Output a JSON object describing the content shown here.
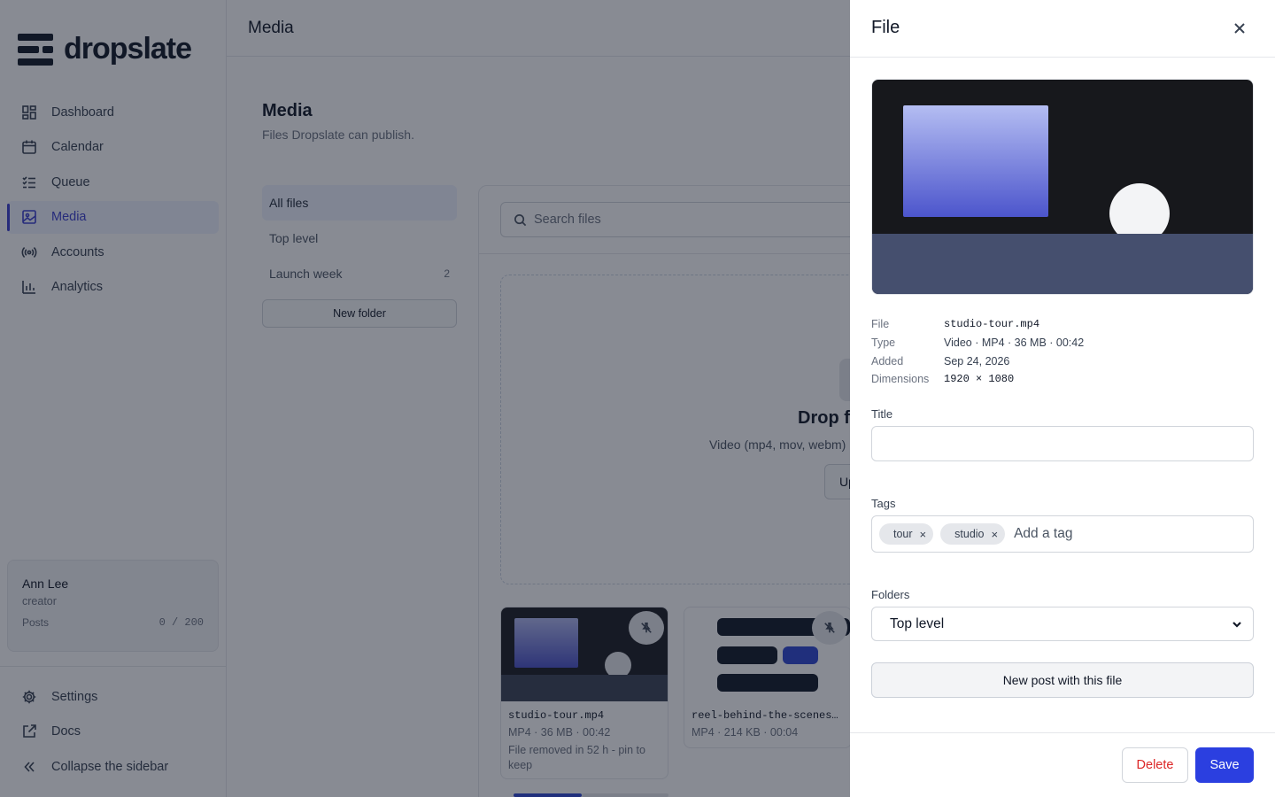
{
  "app": {
    "name": "dropslate"
  },
  "sidebar": {
    "items": [
      {
        "label": "Dashboard",
        "icon": "dashboard-icon"
      },
      {
        "label": "Calendar",
        "icon": "calendar-icon"
      },
      {
        "label": "Queue",
        "icon": "queue-icon"
      },
      {
        "label": "Media",
        "icon": "media-icon",
        "active": true
      },
      {
        "label": "Accounts",
        "icon": "broadcast-icon"
      },
      {
        "label": "Analytics",
        "icon": "bar-chart-icon"
      }
    ],
    "user": {
      "name": "Ann Lee",
      "role": "creator",
      "posts_label": "Posts",
      "posts_value": "0 / 200"
    },
    "bottom_items": [
      {
        "label": "Settings",
        "icon": "gear-icon"
      },
      {
        "label": "Docs",
        "icon": "external-link-icon"
      },
      {
        "label": "Collapse the sidebar",
        "icon": "double-chevron-left-icon"
      }
    ]
  },
  "topbar": {
    "title": "Media"
  },
  "page": {
    "title": "Media",
    "subtitle": "Files Dropslate can publish."
  },
  "folders": {
    "items": [
      {
        "label": "All files",
        "count": "",
        "active": true
      },
      {
        "label": "Top level",
        "count": ""
      },
      {
        "label": "Launch week",
        "count": "2"
      }
    ],
    "new_folder_label": "New folder"
  },
  "search": {
    "placeholder": "Search files"
  },
  "dropzone": {
    "title": "Drop f",
    "subtitle": "Video (mp4, mov, webm)",
    "upload_label": "Up"
  },
  "cards": [
    {
      "name": "studio-tour.mp4",
      "meta": "MP4 · 36 MB · 00:42",
      "note": "File removed in 52 h - pin to keep"
    },
    {
      "name": "reel-behind-the-scenes…",
      "meta": "MP4 · 214 KB · 00:04",
      "note": ""
    }
  ],
  "drawer": {
    "title": "File",
    "meta": [
      {
        "key": "File",
        "value": "studio-tour.mp4"
      },
      {
        "key": "Type",
        "value": "Video · MP4 · 36 MB · 00:42"
      },
      {
        "key": "Added",
        "value": "Sep 24, 2026"
      },
      {
        "key": "Dimensions",
        "value": "1920 × 1080"
      }
    ],
    "title_label": "Title",
    "title_value": "",
    "tags_label": "Tags",
    "tags": [
      "tour",
      "studio"
    ],
    "tag_placeholder": "Add a tag",
    "folders_label": "Folders",
    "folder_value": "Top level",
    "new_post_label": "New post with this file",
    "delete_label": "Delete",
    "save_label": "Save"
  },
  "colors": {
    "accent": "#2b3fe0",
    "danger": "#dc2626",
    "overlay": "rgba(17,24,39,0.5)"
  }
}
